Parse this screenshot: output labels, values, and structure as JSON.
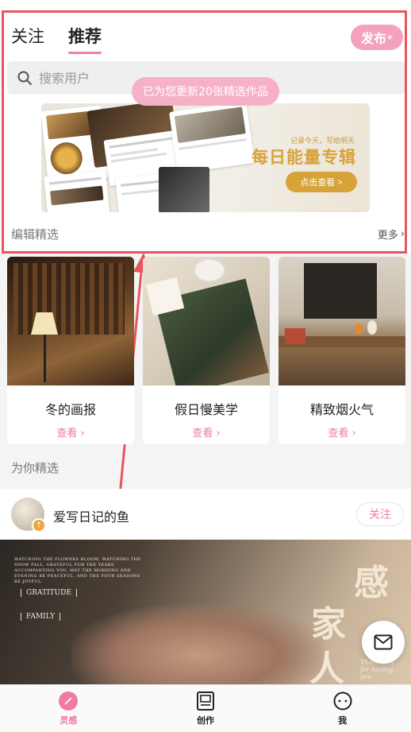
{
  "header": {
    "tabs": [
      {
        "label": "关注",
        "active": false
      },
      {
        "label": "推荐",
        "active": true
      }
    ],
    "publish_label": "发布",
    "publish_sup": "+"
  },
  "search": {
    "placeholder": "搜索用户"
  },
  "toast": "已为您更新20张精选作品",
  "banner": {
    "small_text": "记录今天，写给明天",
    "title": "每日能量专辑",
    "button_label": "点击查看 >"
  },
  "editor_section": {
    "title": "编辑精选",
    "more_label": "更多"
  },
  "cards": [
    {
      "title": "冬的画报",
      "link": "查看"
    },
    {
      "title": "假日慢美学",
      "link": "查看"
    },
    {
      "title": "精致烟火气",
      "link": "查看"
    }
  ],
  "for_you": "为你精选",
  "post": {
    "username": "爱写日记的鱼",
    "follow_label": "关注",
    "image_text": {
      "caption": "WATCHING THE FLOWERS BLOOM, WATCHING THE SNOW FALL. GRATEFUL FOR THE YEARS ACCOMPANYING YOU. MAY THE MORNING AND EVENING BE PEACEFUL, AND THE FOUR SEASONS BE JOYFUL.",
      "badge1": "GRATITUDE",
      "badge2": "FAMILY",
      "cjk1": "感",
      "cjk2": "家",
      "cjk3": "人",
      "thanks": "Thank you for having you"
    }
  },
  "bottom_nav": [
    {
      "label": "灵感",
      "icon": "compass-icon",
      "active": true
    },
    {
      "label": "创作",
      "icon": "create-icon",
      "active": false
    },
    {
      "label": "我",
      "icon": "profile-icon",
      "active": false
    }
  ],
  "colors": {
    "accent": "#f07aa3",
    "annotation": "#e8555d",
    "banner_gold": "#d6a339"
  }
}
